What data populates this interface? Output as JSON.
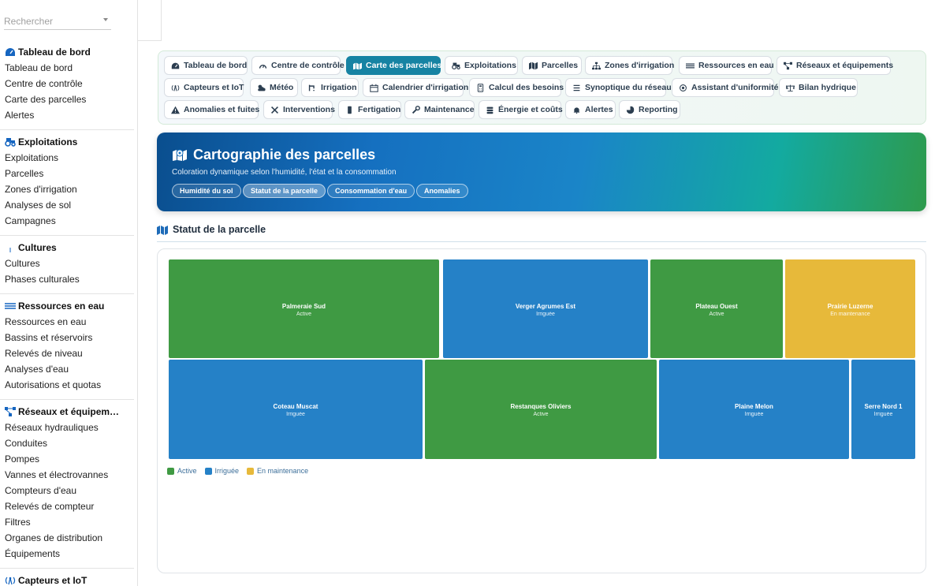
{
  "search": {
    "placeholder": "Rechercher"
  },
  "sidebar": {
    "sections": [
      {
        "title": "Tableau de bord",
        "icon": "dashboard-icon",
        "items": [
          "Tableau de bord",
          "Centre de contrôle",
          "Carte des parcelles",
          "Alertes"
        ]
      },
      {
        "title": "Exploitations",
        "icon": "tractor-icon",
        "items": [
          "Exploitations",
          "Parcelles",
          "Zones d'irrigation",
          "Analyses de sol",
          "Campagnes"
        ]
      },
      {
        "title": "Cultures",
        "icon": "seedling-icon",
        "items": [
          "Cultures",
          "Phases culturales"
        ]
      },
      {
        "title": "Ressources en eau",
        "icon": "water-icon",
        "items": [
          "Ressources en eau",
          "Bassins et réservoirs",
          "Relevés de niveau",
          "Analyses d'eau",
          "Autorisations et quotas"
        ]
      },
      {
        "title": "Réseaux et équipem…",
        "icon": "network-icon",
        "items": [
          "Réseaux hydrauliques",
          "Conduites",
          "Pompes",
          "Vannes et électrovannes",
          "Compteurs d'eau",
          "Relevés de compteur",
          "Filtres",
          "Organes de distribution",
          "Équipements"
        ]
      },
      {
        "title": "Capteurs et IoT",
        "icon": "sensor-icon",
        "items": []
      }
    ]
  },
  "nav": {
    "rows": [
      [
        {
          "label": "Tableau de bord",
          "icon": "dashboard-icon"
        },
        {
          "label": "Centre de contrôle",
          "icon": "gauge-icon"
        },
        {
          "label": "Carte des parcelles",
          "icon": "map-marker-icon",
          "active": true
        },
        {
          "label": "Exploitations",
          "icon": "tractor-icon"
        },
        {
          "label": "Parcelles",
          "icon": "map-icon"
        },
        {
          "label": "Zones d'irrigation",
          "icon": "sitemap-icon"
        },
        {
          "label": "Ressources en eau",
          "icon": "water-icon"
        },
        {
          "label": "Réseaux et équipements",
          "icon": "network-icon"
        }
      ],
      [
        {
          "label": "Capteurs et IoT",
          "icon": "sensor-icon"
        },
        {
          "label": "Météo",
          "icon": "cloud-sun-icon"
        },
        {
          "label": "Irrigation",
          "icon": "faucet-icon"
        },
        {
          "label": "Calendrier d'irrigation",
          "icon": "calendar-icon"
        },
        {
          "label": "Calcul des besoins",
          "icon": "calculator-icon"
        },
        {
          "label": "Synoptique du réseau",
          "icon": "list-icon"
        },
        {
          "label": "Assistant d'uniformité",
          "icon": "target-icon"
        },
        {
          "label": "Bilan hydrique",
          "icon": "balance-icon"
        }
      ],
      [
        {
          "label": "Anomalies et fuites",
          "icon": "warning-icon"
        },
        {
          "label": "Interventions",
          "icon": "tools-icon"
        },
        {
          "label": "Fertigation",
          "icon": "flask-icon"
        },
        {
          "label": "Maintenance",
          "icon": "wrench-icon"
        },
        {
          "label": "Énergie et coûts",
          "icon": "coins-icon"
        },
        {
          "label": "Alertes",
          "icon": "bell-icon"
        },
        {
          "label": "Reporting",
          "icon": "chart-pie-icon"
        }
      ]
    ]
  },
  "hero": {
    "title": "Cartographie des parcelles",
    "subtitle": "Coloration dynamique selon l'humidité, l'état et la consommation",
    "chips": [
      {
        "label": "Humidité du sol",
        "active": false
      },
      {
        "label": "Statut de la parcelle",
        "active": true
      },
      {
        "label": "Consommation d'eau",
        "active": false
      },
      {
        "label": "Anomalies",
        "active": false
      }
    ]
  },
  "section": {
    "title": "Statut de la parcelle"
  },
  "colors": {
    "active": "#3f9a43",
    "irrigated": "#2581c7",
    "maintenance": "#e7b93a"
  },
  "treemap": {
    "tiles": [
      {
        "name": "Palmeraie Sud",
        "status": "Active",
        "kind": "active"
      },
      {
        "name": "Verger Agrumes Est",
        "status": "Irriguée",
        "kind": "irrigated"
      },
      {
        "name": "Plateau Ouest",
        "status": "Active",
        "kind": "active"
      },
      {
        "name": "Prairie Luzerne",
        "status": "En maintenance",
        "kind": "maintenance"
      },
      {
        "name": "Coteau Muscat",
        "status": "Irriguée",
        "kind": "irrigated"
      },
      {
        "name": "Restanques Oliviers",
        "status": "Active",
        "kind": "active"
      },
      {
        "name": "Plaine Melon",
        "status": "Irriguée",
        "kind": "irrigated"
      },
      {
        "name": "Serre Nord 1",
        "status": "Irriguée",
        "kind": "irrigated"
      }
    ]
  },
  "legend": [
    {
      "label": "Active",
      "kind": "active"
    },
    {
      "label": "Irriguée",
      "kind": "irrigated"
    },
    {
      "label": "En maintenance",
      "kind": "maintenance"
    }
  ]
}
